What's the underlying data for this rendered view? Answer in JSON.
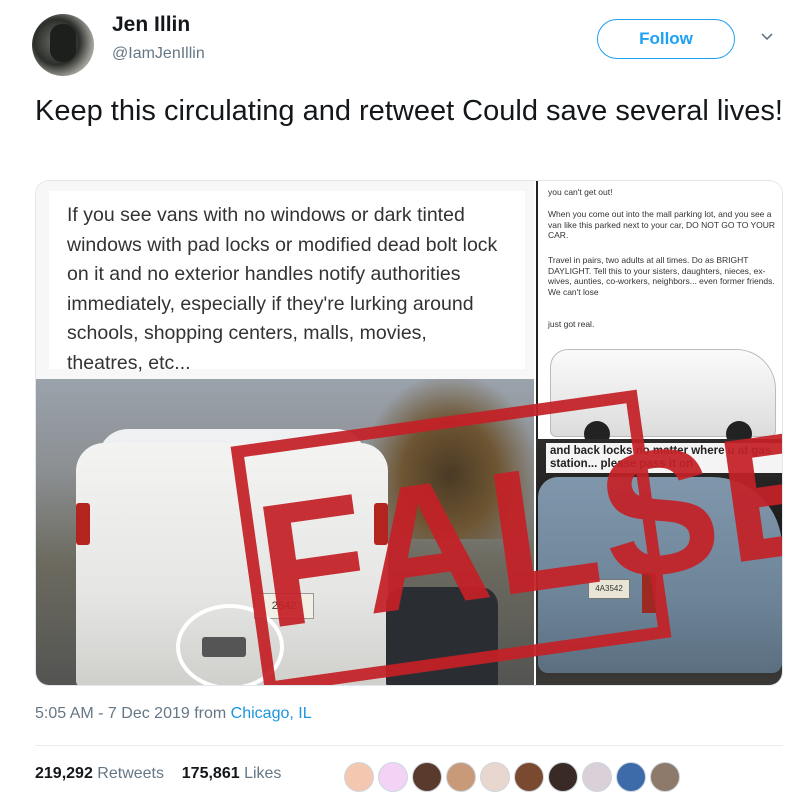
{
  "author": {
    "name": "Jen Illin",
    "handle": "@IamJenIllin",
    "avatar_icon": "profile-photo"
  },
  "follow_button": {
    "label": "Follow",
    "color": "#1da1f2"
  },
  "menu_icon": "chevron-down-icon",
  "tweet": {
    "text": "Keep this circulating and retweet Could save several lives!"
  },
  "media": {
    "text_card": "If you see vans with no windows or dark tinted windows with pad locks or modified dead bolt lock on it and no exterior handles notify authorities immediately, especially if they're lurking around schools, shopping centers, malls, movies, theatres, etc...",
    "right_card_top": "you can't get out!",
    "right_card_body": "When you come out into the mall parking lot, and you see a van like this parked next to your car, DO NOT GO TO YOUR CAR.",
    "right_card_body2": "Travel in pairs, two adults at all times. Do as BRIGHT DAYLIGHT. Tell this to your sisters, daughters, nieces, ex-wives, aunties, co-workers, neighbors... even former friends. We can't lose",
    "right_card_body3": "just got real.",
    "photo3_caption": "and back locks no matter where u at gas station... please pass it on",
    "plate_1": "2542",
    "plate_3": "4A3542",
    "stamp_text": "FALSE",
    "stamp_color": "#c42127"
  },
  "footer": {
    "time": "5:05 AM - 7 Dec 2019 from ",
    "location": "Chicago, IL",
    "retweets_count": "219,292",
    "retweets_label": "Retweets",
    "likes_count": "175,861",
    "likes_label": "Likes",
    "likers": [
      "#f4c7b0",
      "#f2d3f5",
      "#5b3a2e",
      "#c89a7a",
      "#e8d7cf",
      "#7a4a30",
      "#3a2a26",
      "#dad0d8",
      "#3d6aa8",
      "#8d7a6a"
    ]
  }
}
